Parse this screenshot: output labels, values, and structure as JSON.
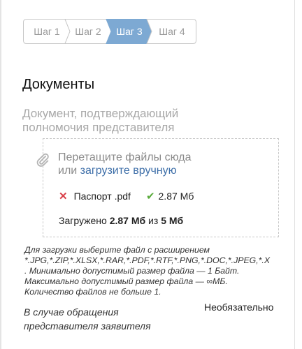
{
  "stepper": {
    "steps": [
      {
        "label": "Шаг 1"
      },
      {
        "label": "Шаг 2"
      },
      {
        "label": "Шаг 3"
      },
      {
        "label": "Шаг 4"
      }
    ],
    "active_step": 3,
    "active_color": "#7da9d3"
  },
  "section": {
    "title": "Документы"
  },
  "document": {
    "title_line1": "Документ, подтверждающий",
    "title_line2": "полномочия представителя"
  },
  "dropzone": {
    "icon": "paperclip-icon",
    "drag_text": "Перетащите файлы сюда",
    "or_text": "или",
    "upload_link": "загрузите вручную"
  },
  "file": {
    "name": "Паспорт .pdf",
    "size": "2.87 Мб",
    "remove_icon": "close-icon",
    "status_icon": "check-icon"
  },
  "upload_summary": {
    "prefix": "Загружено",
    "uploaded": "2.87 Мб",
    "of": "из",
    "limit": "5 Мб"
  },
  "hint": {
    "line1": "Для загрузки выберите файл с расширением",
    "line2": "*.JPG,*.ZIP,*.XLSX,*.RAR,*.PDF,*.RTF,*.PNG,*.DOC,*.JPEG,*.X",
    "line3": ". Минимально допустимый размер файла — 1 Байт.",
    "line4": "Максимально допустимый размер файла — ∞МБ.",
    "line5": "Количество файлов не больше 1."
  },
  "representative_note": {
    "line1": "В случае обращения",
    "line2": "представителя заявителя"
  },
  "optional_label": "Необязательно"
}
